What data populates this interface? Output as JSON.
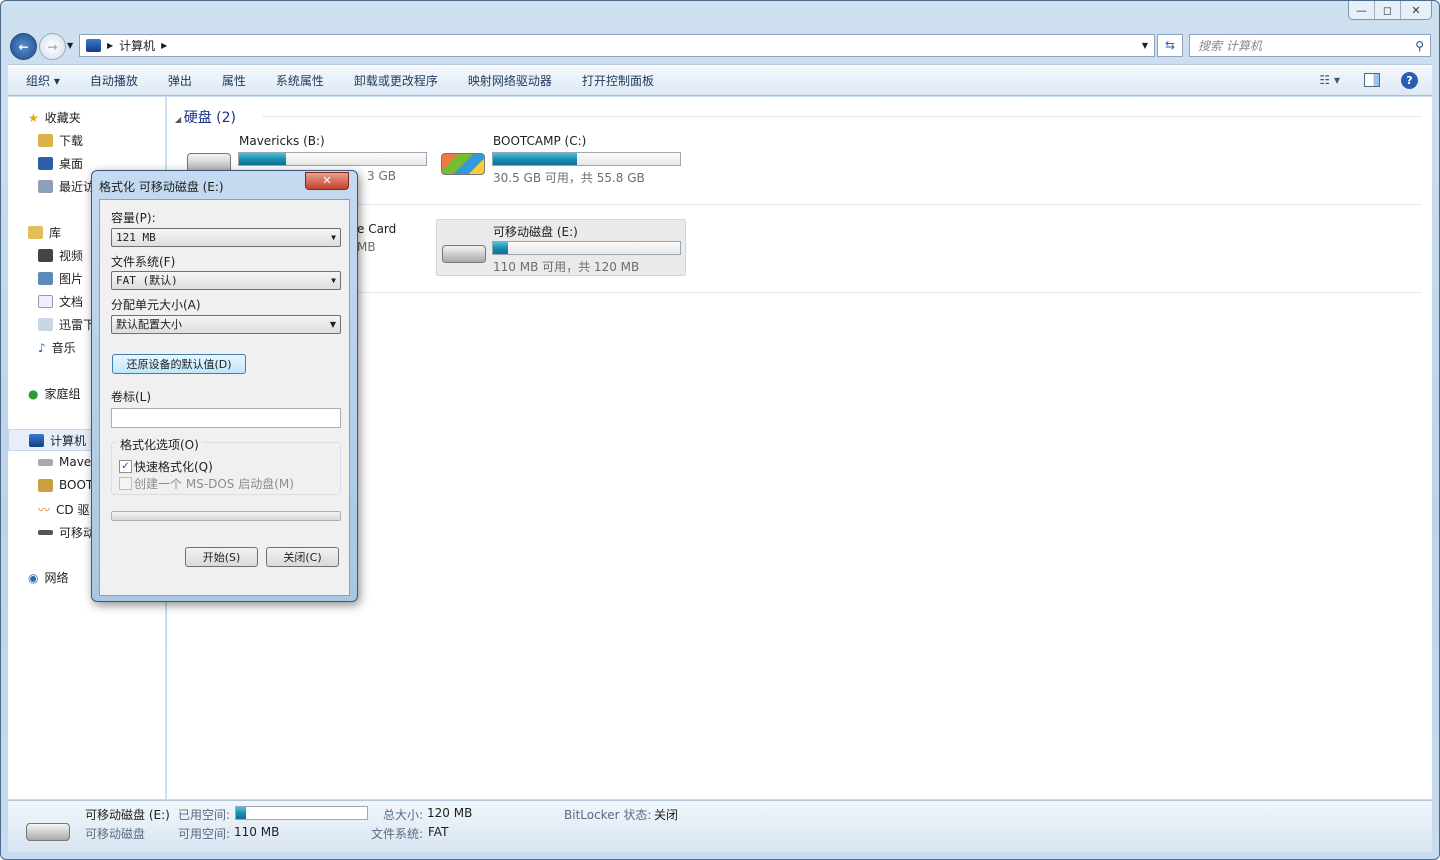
{
  "window": {
    "controls": {
      "minimize": "—",
      "maximize": "◻",
      "close": "✕"
    }
  },
  "nav": {
    "back": "←",
    "forward": "→",
    "path": [
      "计算机"
    ],
    "search_placeholder": "搜索 计算机"
  },
  "toolbar": {
    "items": [
      "组织 ▾",
      "自动播放",
      "弹出",
      "属性",
      "系统属性",
      "卸载或更改程序",
      "映射网络驱动器",
      "打开控制面板"
    ]
  },
  "sidebar": {
    "favorites": "收藏夹",
    "fav_items": [
      "下载",
      "桌面",
      "最近访"
    ],
    "libraries": "库",
    "lib_items": [
      "视频",
      "图片",
      "文档",
      "迅雷下",
      "音乐"
    ],
    "homegroup": "家庭组",
    "computer": "计算机",
    "comp_items": [
      "Mave",
      "BOOT",
      "CD 驱",
      "可移动"
    ],
    "network": "网络"
  },
  "main": {
    "group1": "硬盘 (2)",
    "drives": [
      {
        "name": "Mavericks (B:)",
        "usage": 0.25,
        "info_fragment": "3 GB"
      },
      {
        "name": "BOOTCAMP (C:)",
        "usage": 0.45,
        "info": "30.5 GB 可用，共 55.8 GB"
      }
    ],
    "group2_fragments": [
      "e Card",
      "MB"
    ],
    "removable": {
      "name": "可移动磁盘 (E:)",
      "usage": 0.08,
      "info": "110 MB 可用，共 120 MB"
    }
  },
  "dialog": {
    "title": "格式化 可移动磁盘 (E:)",
    "close": "✕",
    "capacity_label": "容量(P):",
    "capacity": "121 MB",
    "fs_label": "文件系统(F)",
    "fs": "FAT (默认)",
    "alloc_label": "分配单元大小(A)",
    "alloc": "默认配置大小",
    "restore": "还原设备的默认值(D)",
    "volume_label": "卷标(L)",
    "volume_value": "",
    "options_label": "格式化选项(O)",
    "quick": "快速格式化(Q)",
    "quick_checked": true,
    "msdos": "创建一个 MS-DOS 启动盘(M)",
    "msdos_checked": false,
    "progress": 0,
    "start": "开始(S)",
    "close_btn": "关闭(C)"
  },
  "status": {
    "name": "可移动磁盘 (E:)",
    "type": "可移动磁盘",
    "used_label": "已用空间:",
    "used": 0.08,
    "free_label": "可用空间:",
    "free": "110 MB",
    "total_label": "总大小:",
    "total": "120 MB",
    "fs_label": "文件系统:",
    "fs": "FAT",
    "bitlocker_label": "BitLocker 状态:",
    "bitlocker": "关闭"
  }
}
